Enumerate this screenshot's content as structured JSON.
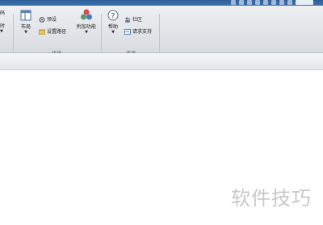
{
  "ribbon": {
    "partial_labels": {
      "top": "码",
      "mid": "时"
    },
    "layout_button": {
      "label": "布局"
    },
    "preferences": {
      "label": "预设"
    },
    "set_path": {
      "label": "设置路径"
    },
    "addons": {
      "label": "附加功能"
    },
    "help": {
      "label": "帮助"
    },
    "community": {
      "label": "社区"
    },
    "request_support": {
      "label": "请求支持"
    },
    "groups": {
      "environment": "环境",
      "resources": "资源"
    }
  },
  "watermark": {
    "text": "软件技巧"
  }
}
